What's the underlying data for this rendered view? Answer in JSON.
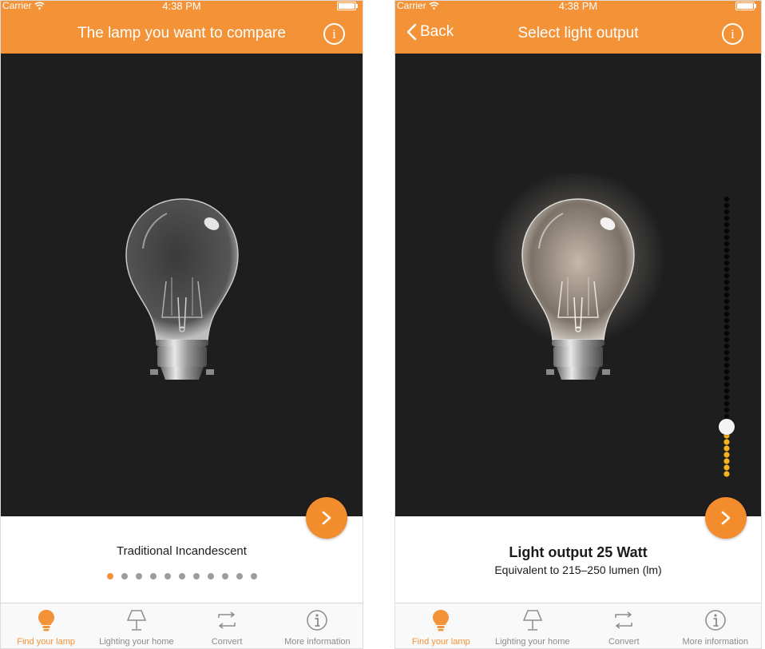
{
  "status": {
    "carrier": "Carrier",
    "time": "4:38 PM"
  },
  "screen_left": {
    "title": "The lamp you want to compare",
    "lamp_name": "Traditional Incandescent",
    "page_dots_count": 11,
    "active_dot": 0
  },
  "screen_right": {
    "back_label": "Back",
    "title": "Select light output",
    "output_title": "Light output 25 Watt",
    "output_subtitle": "Equivalent to 215–250 lumen (lm)",
    "slider_level": 0.18
  },
  "tabs": [
    {
      "label": "Find your lamp",
      "icon": "bulb-icon",
      "active": true
    },
    {
      "label": "Lighting your home",
      "icon": "table-lamp-icon",
      "active": false
    },
    {
      "label": "Convert",
      "icon": "convert-arrows-icon",
      "active": false
    },
    {
      "label": "More information",
      "icon": "info-circle-icon",
      "active": false
    }
  ],
  "colors": {
    "accent": "#f39237",
    "stage": "#1e1e1e",
    "inactive_tab": "#8c8c8c",
    "dot_inactive": "#9d9d9d"
  }
}
